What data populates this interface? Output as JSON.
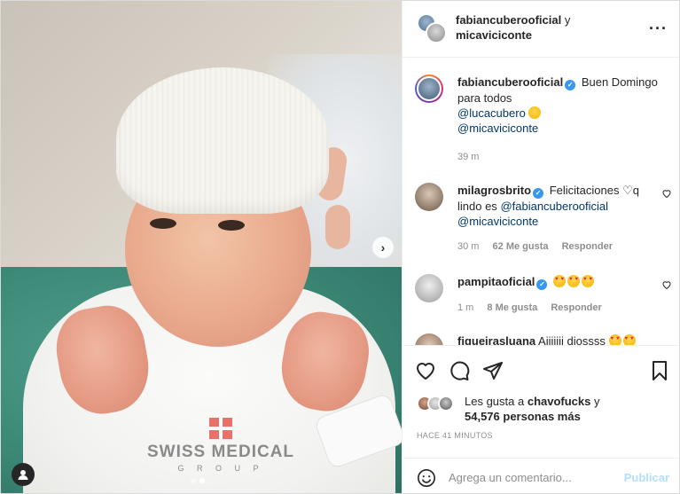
{
  "photo": {
    "logo_text": "SWISS MEDICAL",
    "logo_sub": "G R O U P",
    "next_icon": "chevron-right-icon",
    "tag_icon": "user-tag-icon"
  },
  "header": {
    "user1": "fabiancuberooficial",
    "joiner": "y",
    "user2": "micaviciconte",
    "more_icon": "more-dots-icon"
  },
  "caption": {
    "username": "fabiancuberooficial",
    "text": "Buen Domingo para todos",
    "mention1": "@lucacubero",
    "mention2": "@micaviciconte",
    "time": "39 m"
  },
  "comments": [
    {
      "username": "milagrosbrito",
      "text_before": "Felicitaciones ♡q lindo es",
      "mention1": "@fabiancuberooficial",
      "mention2": "@micaviciconte",
      "time": "30 m",
      "likes": "62 Me gusta",
      "reply": "Responder"
    },
    {
      "username": "pampitaoficial",
      "time": "1 m",
      "likes": "8 Me gusta",
      "reply": "Responder"
    },
    {
      "username": "figueirasluana",
      "text": "Aiiiiiii diossss"
    }
  ],
  "likes": {
    "prefix": "Les gusta a",
    "user": "chavofucks",
    "suffix": "y",
    "count": "54,576 personas más"
  },
  "timestamp": "HACE 41 MINUTOS",
  "add_comment": {
    "placeholder": "Agrega un comentario...",
    "post_label": "Publicar"
  },
  "colors": {
    "verified": "#3897f0",
    "post_disabled": "#b2dffc",
    "mention": "#00376b"
  }
}
